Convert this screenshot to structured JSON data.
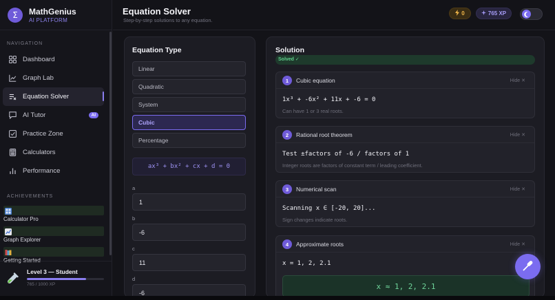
{
  "brand": {
    "logo": "Σ",
    "name": "MathGenius",
    "subtitle": "AI PLATFORM"
  },
  "sidebar": {
    "nav_label": "NAVIGATION",
    "items": [
      {
        "label": "Dashboard",
        "icon": "grid-icon"
      },
      {
        "label": "Graph Lab",
        "icon": "line-chart-icon"
      },
      {
        "label": "Equation Solver",
        "icon": "equation-icon",
        "active": true
      },
      {
        "label": "AI Tutor",
        "icon": "chat-icon",
        "badge": "AI"
      },
      {
        "label": "Practice Zone",
        "icon": "checkbox-icon"
      },
      {
        "label": "Calculators",
        "icon": "calculator-icon"
      },
      {
        "label": "Performance",
        "icon": "bar-chart-icon"
      }
    ],
    "achievements_label": "ACHIEVEMENTS",
    "achievements": [
      {
        "name": "Calculator Pro",
        "icon": "calculator-emoji-icon"
      },
      {
        "name": "Graph Explorer",
        "icon": "chart-emoji-icon"
      },
      {
        "name": "Getting Started",
        "icon": "books-emoji-icon"
      }
    ],
    "level": {
      "title": "Level 3 — Student",
      "xp_text": "765 / 1000 XP",
      "progress": 0.765,
      "icon": "test-tube-icon"
    }
  },
  "header": {
    "title": "Equation Solver",
    "subtitle": "Step-by-step solutions to any equation.",
    "streak": "0",
    "xp": "765 XP",
    "theme_icon": "moon-icon"
  },
  "equation_type": {
    "title": "Equation Type",
    "types": [
      "Linear",
      "Quadratic",
      "System",
      "Cubic",
      "Percentage"
    ],
    "selected": "Cubic",
    "formula": "ax³ + bx² + cx + d = 0",
    "coefficients": [
      {
        "label": "a",
        "value": "1"
      },
      {
        "label": "b",
        "value": "-6"
      },
      {
        "label": "c",
        "value": "11"
      },
      {
        "label": "d",
        "value": "-6"
      }
    ]
  },
  "solution": {
    "title": "Solution",
    "status": "Solved ✓",
    "hide_label": "Hide ✕",
    "steps": [
      {
        "num": "1",
        "title": "Cubic equation",
        "expr": "1x³ + -6x² + 11x + -6 = 0",
        "note": "Can have 1 or 3 real roots."
      },
      {
        "num": "2",
        "title": "Rational root theorem",
        "expr": "Test ±factors of -6 / factors of 1",
        "note": "Integer roots are factors of constant term / leading coefficient."
      },
      {
        "num": "3",
        "title": "Numerical scan",
        "expr": "Scanning x ∈ [-20, 20]...",
        "note": "Sign changes indicate roots."
      },
      {
        "num": "4",
        "title": "Approximate roots",
        "expr": "x = 1, 2, 2.1",
        "answer": "x ≈ 1, 2, 2.1"
      }
    ]
  },
  "fab": {
    "icon": "microphone-icon"
  },
  "colors": {
    "accent": "#7b6cf0",
    "success": "#5fd08c",
    "warning": "#f2b74a"
  }
}
